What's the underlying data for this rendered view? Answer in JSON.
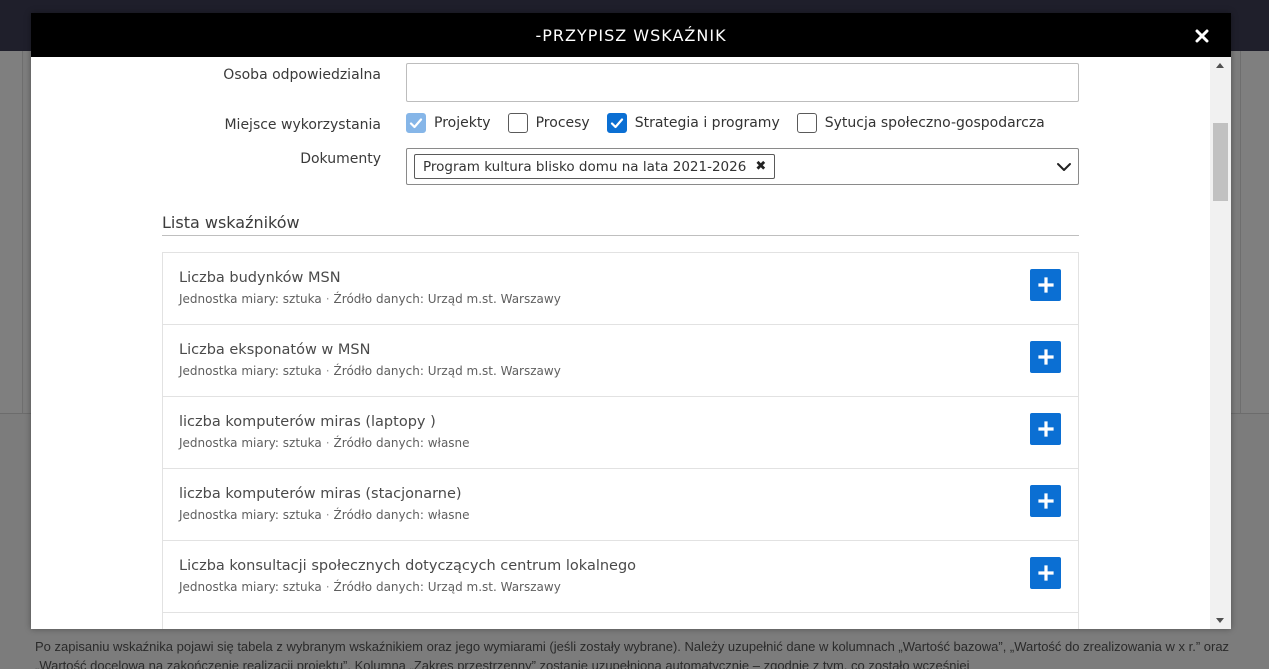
{
  "modal": {
    "title": "-PRZYPISZ WSKAŹNIK",
    "close_icon": "close-icon"
  },
  "form": {
    "osoba_label": "Osoba odpowiedzialna",
    "osoba_value": "",
    "miejsce_label": "Miejsce wykorzystania",
    "options": [
      {
        "label": "Projekty",
        "checked": true,
        "style": "light"
      },
      {
        "label": "Procesy",
        "checked": false,
        "style": "none"
      },
      {
        "label": "Strategia i programy",
        "checked": true,
        "style": "dark"
      },
      {
        "label": "Sytucja społeczno-gospodarcza",
        "checked": false,
        "style": "none"
      }
    ],
    "dokumenty_label": "Dokumenty",
    "dokumenty_selected": "Program kultura blisko domu na lata 2021-2026"
  },
  "list": {
    "title": "Lista wskaźników",
    "unit_prefix": "Jednostka miary:",
    "source_prefix": "Źródło danych:",
    "items": [
      {
        "name": "Liczba budynków MSN",
        "unit": "sztuka",
        "source": "Urząd m.st. Warszawy"
      },
      {
        "name": "Liczba eksponatów w MSN",
        "unit": "sztuka",
        "source": "Urząd m.st. Warszawy"
      },
      {
        "name": "liczba komputerów miras (laptopy )",
        "unit": "sztuka",
        "source": "własne"
      },
      {
        "name": "liczba komputerów miras (stacjonarne)",
        "unit": "sztuka",
        "source": "własne"
      },
      {
        "name": "Liczba konsultacji społecznych dotyczących centrum lokalnego",
        "unit": "sztuka",
        "source": "Urząd m.st. Warszawy"
      }
    ]
  },
  "background": {
    "footer_text": "Po zapisaniu wskaźnika pojawi się tabela z wybranym wskaźnikiem oraz jego wymiarami (jeśli zostały wybrane). Należy uzupełnić dane w kolumnach „Wartość bazowa”, „Wartość do zrealizowania w x r.” oraz „Wartość docelowa na zakończenie realizacji projektu”. Kolumna „Zakres przestrzenny” zostanie uzupełniona automatycznie – zgodnie z tym, co zostało wcześniej"
  },
  "colors": {
    "primary": "#0b6fd3",
    "header": "#000000"
  }
}
